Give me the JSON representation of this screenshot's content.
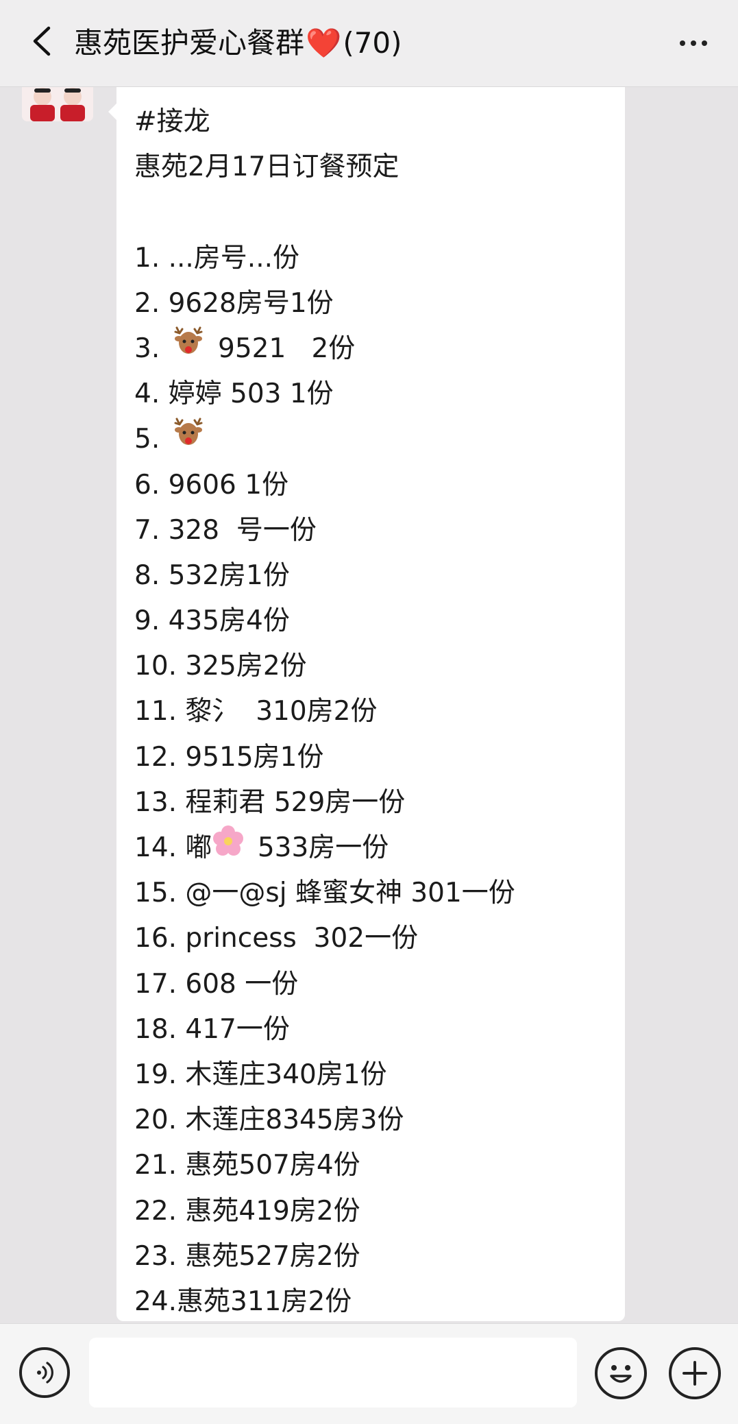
{
  "header": {
    "title": "惠苑医护爱心餐群",
    "title_emoji": "❤️",
    "member_count": "(70)"
  },
  "message": {
    "lines": [
      "#接龙",
      "惠苑2月17日订餐预定",
      "",
      "1. ...房号...份",
      "2. 9628房号1份",
      "3. 🦌 9521   2份",
      "4. 婷婷 503 1份",
      "5. 🦌",
      "6. 9606 1份",
      "7. 328  号一份",
      "8. 532房1份",
      "9. 435房4份",
      "10. 325房2份",
      "11. 黎氵  310房2份",
      "12. 9515房1份",
      "13. 程莉君 529房一份",
      "14. 嘟🌸 533房一份",
      "15. @一@sj 蜂蜜女神 301一份",
      "16. princess  302一份",
      "17. 608 一份",
      "18. 417一份",
      "19. 木莲庄340房1份",
      "20. 木莲庄8345房3份",
      "21. 惠苑507房4份",
      "22. 惠苑419房2份",
      "23. 惠苑527房2份",
      "24.惠苑311房2份"
    ]
  },
  "input": {
    "placeholder": ""
  },
  "icons": {
    "back": "chevron-left-icon",
    "more": "more-dots-icon",
    "voice": "voice-icon",
    "emoji": "emoji-icon",
    "plus": "plus-icon"
  }
}
